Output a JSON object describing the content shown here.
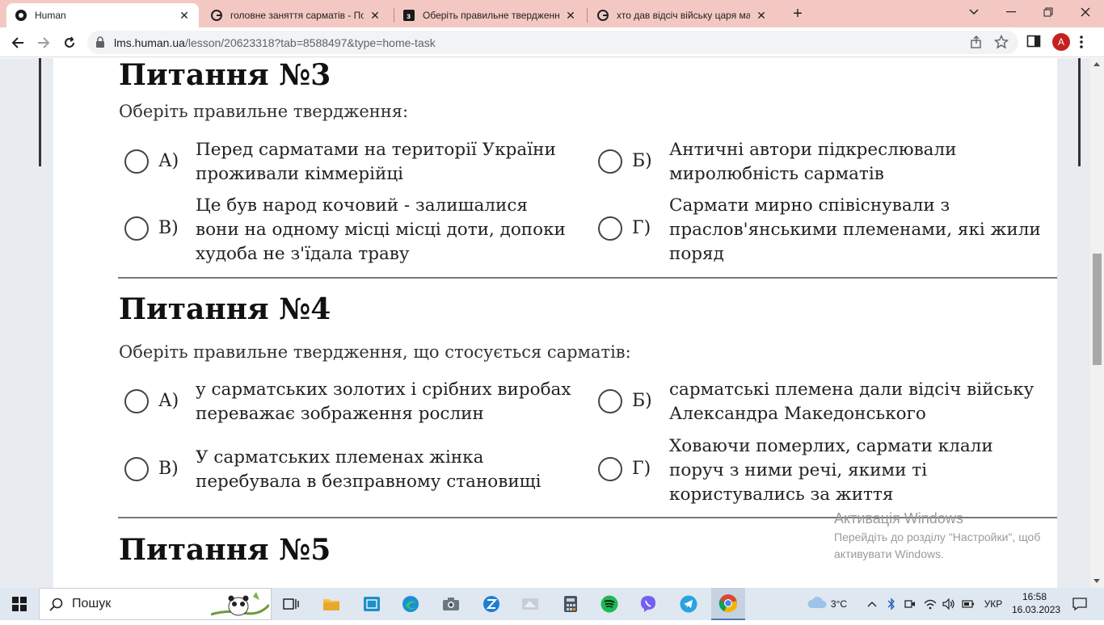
{
  "browser": {
    "tabs": [
      {
        "title": "Human",
        "icon": "human-logo-icon",
        "active": true
      },
      {
        "title": "головне заняття сарматів - Пош",
        "icon": "google-icon",
        "active": false
      },
      {
        "title": "Оберіть правильне твердження",
        "icon": "znanija-icon",
        "active": false
      },
      {
        "title": "хто дав відсіч війську царя маке",
        "icon": "google-icon",
        "active": false
      }
    ],
    "url_domain": "lms.human.ua",
    "url_path": "/lesson/20623318?tab=8588497&type=home-task",
    "profile_initial": "A"
  },
  "questions": [
    {
      "title": "Питання №3",
      "prompt": "Оберіть правильне твердження:",
      "options": [
        {
          "letter": "А)",
          "lines": [
            "Перед сарматами на території України",
            "проживали кіммерійці"
          ]
        },
        {
          "letter": "Б)",
          "lines": [
            "Античні автори підкреслювали",
            "миролюбність сарматів"
          ]
        },
        {
          "letter": "В)",
          "lines": [
            "Це був народ кочовий - залишалися",
            "вони на одному місці місці доти, допоки",
            "худоба не з'їдала траву"
          ]
        },
        {
          "letter": "Г)",
          "lines": [
            "Сармати мирно співіснували з",
            "праслов'янськими племенами, які жили",
            "поряд"
          ]
        }
      ]
    },
    {
      "title": "Питання №4",
      "prompt": "Оберіть правильне твердження, що стосується сарматів:",
      "options": [
        {
          "letter": "А)",
          "lines": [
            "у сарматських золотих і срібних виробах",
            "переважає зображення рослин"
          ]
        },
        {
          "letter": "Б)",
          "lines": [
            "сарматські племена дали відсіч війську",
            "Александра Македонського"
          ]
        },
        {
          "letter": "В)",
          "lines": [
            "У сарматських племенах жінка",
            "перебувала в безправному становищі"
          ]
        },
        {
          "letter": "Г)",
          "lines": [
            "Ховаючи померлих, сармати клали",
            "поруч з ними речі, якими ті",
            "користувались за життя"
          ]
        }
      ]
    },
    {
      "title": "Питання №5"
    }
  ],
  "activation": {
    "title": "Активація Windows",
    "line1": "Перейдіть до розділу \"Настройки\", щоб",
    "line2": "активувати Windows."
  },
  "taskbar": {
    "search_label": "Пошук",
    "weather": "3°C",
    "language": "УКР",
    "time": "16:58",
    "date": "16.03.2023"
  }
}
